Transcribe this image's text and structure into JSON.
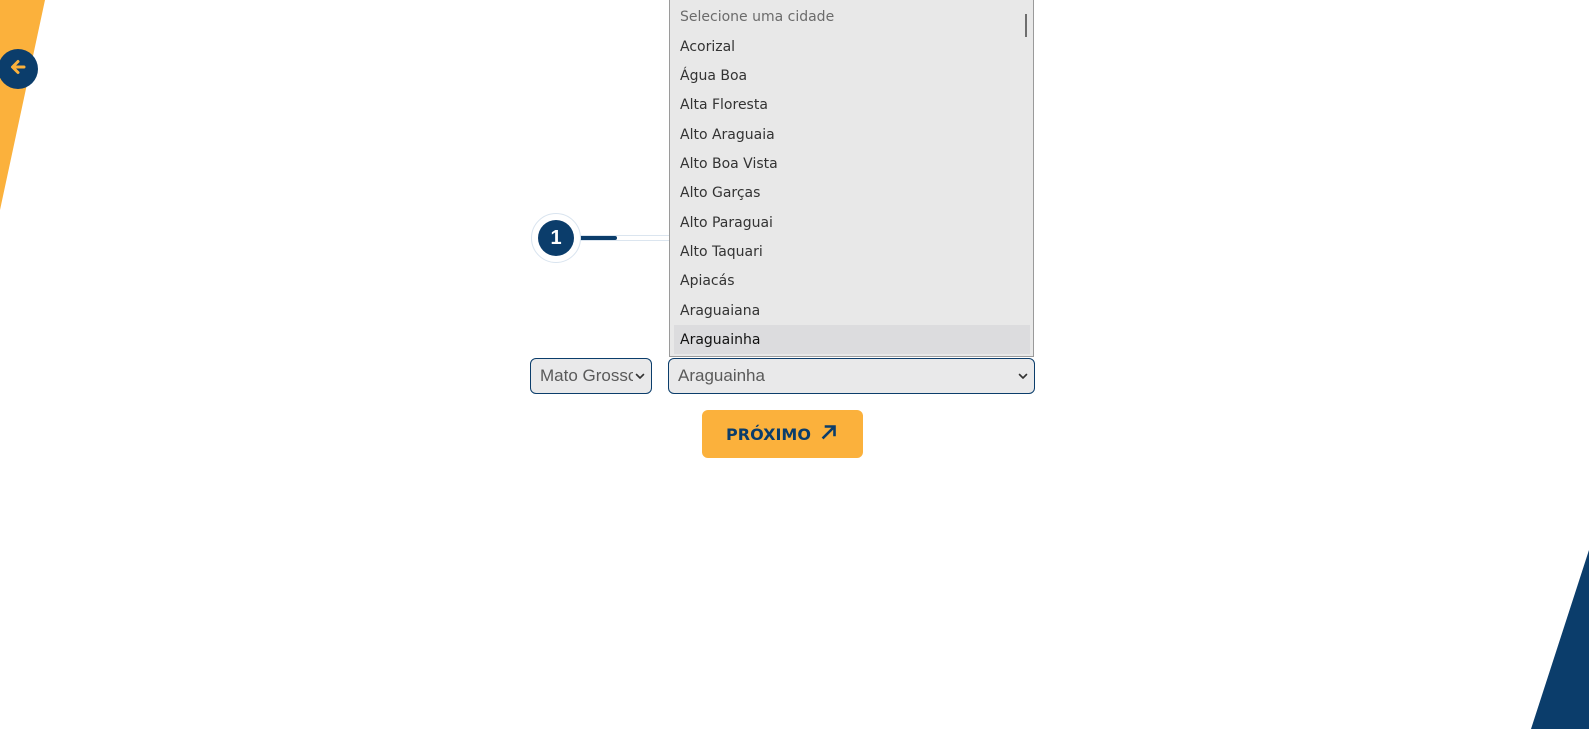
{
  "colors": {
    "navy": "#0b3d6b",
    "accent_orange": "#fbb13c",
    "select_background": "#e9e9ea",
    "dropdown_background": "#e8e8e8"
  },
  "navigation": {
    "back_icon": "arrow-left-icon"
  },
  "stepper": {
    "current_step": "1",
    "progress": 0.09
  },
  "state_select": {
    "value": "Mato Grosso",
    "icon": "chevron-down-icon"
  },
  "city_select": {
    "value": "Araguainha",
    "icon": "chevron-down-icon",
    "open": true,
    "options": [
      "Selecione uma cidade",
      "Acorizal",
      "Água Boa",
      "Alta Floresta",
      "Alto Araguaia",
      "Alto Boa Vista",
      "Alto Garças",
      "Alto Paraguai",
      "Alto Taquari",
      "Apiacás",
      "Araguaiana",
      "Araguainha"
    ],
    "selected_option": "Araguainha"
  },
  "next_button": {
    "label": "PRÓXIMO",
    "icon": "arrow-up-right-icon"
  }
}
